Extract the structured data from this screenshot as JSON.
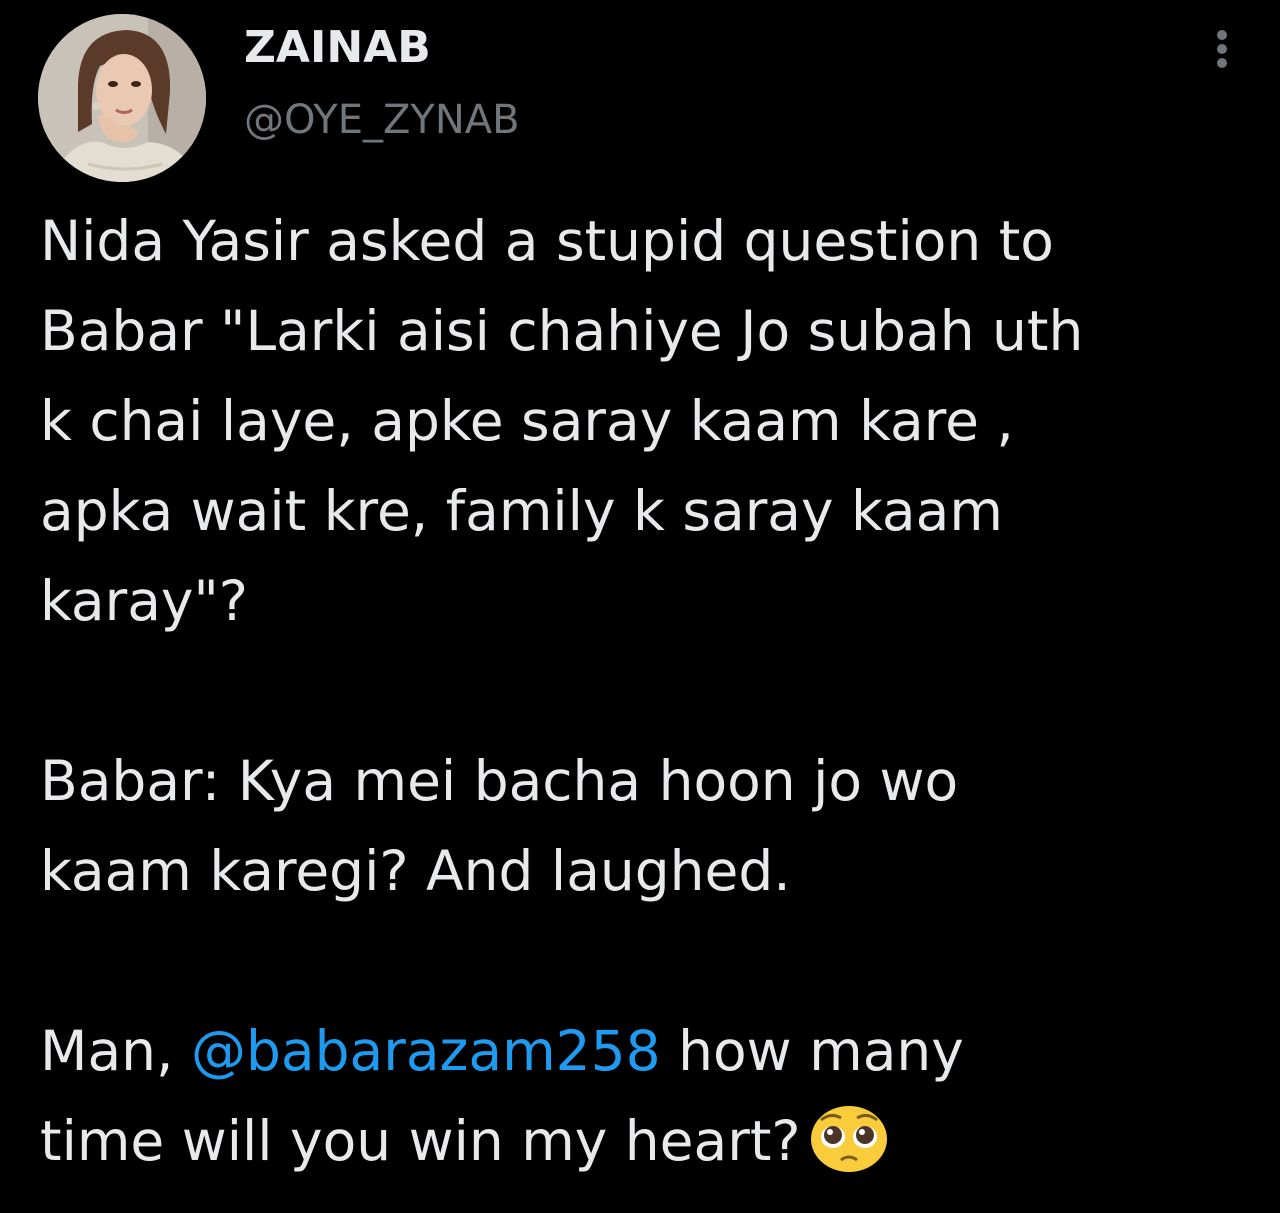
{
  "tweet": {
    "author": {
      "display_name": "ZAINAB",
      "handle": "@OYE_ZYNAB",
      "avatar_icon": "profile-photo"
    },
    "menu_icon": "more-options-vertical-icon",
    "body": {
      "paragraph_1": "Nida Yasir asked a stupid question to\nBabar \"Larki aisi chahiye Jo subah uth\nk chai laye, apke saray kaam kare ,\napka wait kre, family k saray kaam\nkaray\"?",
      "paragraph_2": "Babar: Kya mei bacha hoon jo wo\nkaam karegi? And laughed.",
      "paragraph_3_before": "Man, ",
      "mention": "@babarazam258",
      "paragraph_3_after": " how many\ntime will you win my heart?",
      "emoji_icon": "pleading-face-emoji"
    }
  },
  "colors": {
    "background": "#000000",
    "primary_text": "#e7e9ea",
    "secondary_text": "#71767b",
    "link": "#1d9bf0"
  }
}
